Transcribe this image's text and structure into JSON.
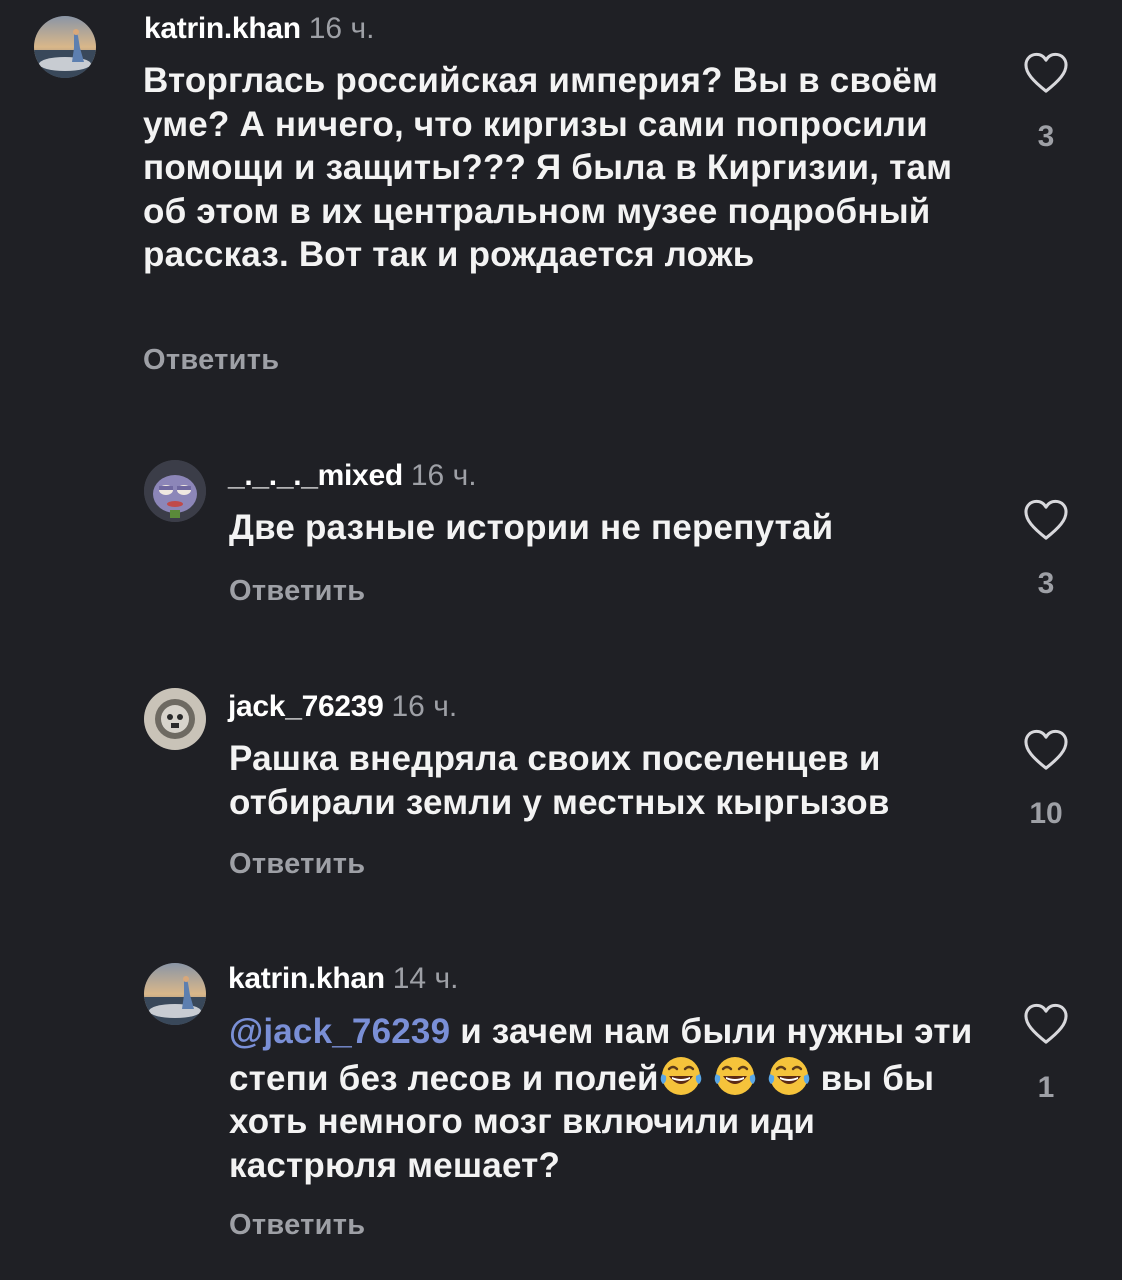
{
  "reply_label": "Ответить",
  "comments": [
    {
      "username": "katrin.khan",
      "time": "16 ч.",
      "text": "Вторглась российская империя? Вы в своём уме? А ничего, что киргизы сами попросили помощи и защиты??? Я была в Киргизии, там об этом в их центральном музее подробный рассказ. Вот так и рождается ложь",
      "likes": "3"
    },
    {
      "username": "_._._._mixed",
      "time": "16 ч.",
      "text": "Две разные истории не перепутай",
      "likes": "3"
    },
    {
      "username": "jack_76239",
      "time": "16 ч.",
      "text": "Рашка внедряла своих поселенцев и отбирали земли у местных кыргызов",
      "likes": "10"
    },
    {
      "username": "katrin.khan",
      "time": "14 ч.",
      "mention": "@jack_76239",
      "text_part1": "и зачем нам были нужны эти степи без лесов и полей",
      "text_part2": "вы бы хоть немного мозг включили иди кастрюля мешает?",
      "likes": "1"
    }
  ]
}
